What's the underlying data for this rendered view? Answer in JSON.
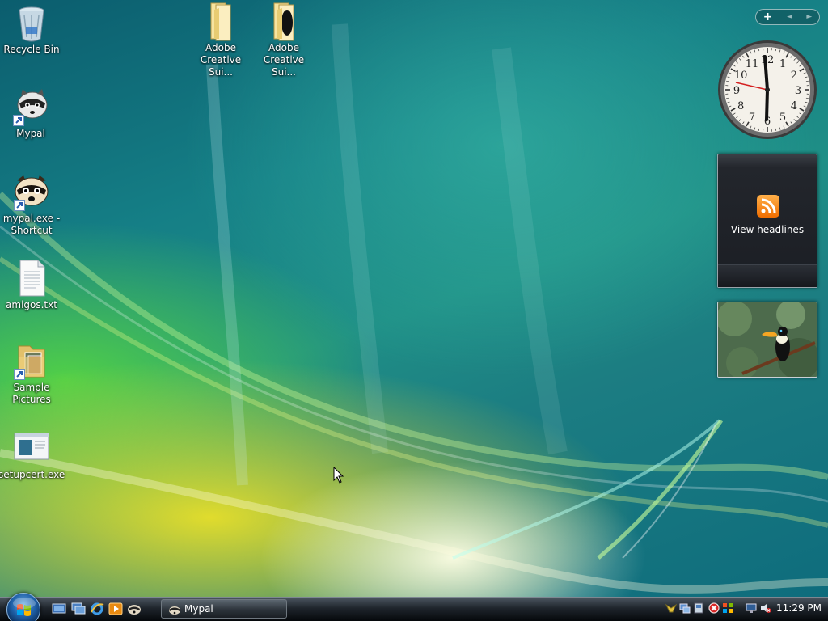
{
  "desktop": {
    "icons": [
      {
        "label": "Recycle Bin",
        "icon": "recycle-bin-icon"
      },
      {
        "label": "Mypal",
        "icon": "raccoon-icon",
        "shortcut": true
      },
      {
        "label": "mypal.exe - Shortcut",
        "icon": "raccoon-icon",
        "shortcut": true
      },
      {
        "label": "amigos.txt",
        "icon": "text-file-icon"
      },
      {
        "label": "Sample Pictures",
        "icon": "folder-icon",
        "shortcut": true
      },
      {
        "label": "setupcert.exe",
        "icon": "setup-exe-icon"
      },
      {
        "label": "Adobe Creative Sui...",
        "icon": "folder-icon"
      },
      {
        "label": "Adobe Creative Sui...",
        "icon": "folder-icon"
      }
    ]
  },
  "sidebar": {
    "controls": {
      "add": "+",
      "prev": "◄",
      "next": "►"
    },
    "clock": {
      "numerals": [
        "12",
        "1",
        "2",
        "3",
        "4",
        "5",
        "6",
        "7",
        "8",
        "9",
        "10",
        "11"
      ]
    },
    "feed": {
      "label": "View headlines"
    },
    "slideshow": {
      "subject": "toucan"
    }
  },
  "taskbar": {
    "start_button": "start-orb",
    "quick_launch": [
      "show-desktop-icon",
      "switch-windows-icon",
      "internet-explorer-icon",
      "media-player-icon",
      "mypal-icon"
    ],
    "task_buttons": [
      {
        "label": "Mypal",
        "icon": "mypal-icon"
      }
    ],
    "tray_icons": [
      "tray-app-icon",
      "tray-network-icon",
      "tray-device-icon",
      "tray-security-icon",
      "tray-windows-icon",
      "tray-display-icon",
      "volume-muted-icon"
    ],
    "clock": "11:29 PM"
  },
  "colors": {
    "accent_orange": "#f06d00",
    "taskbar_dark": "#1f252c",
    "wallpaper_teal": "#157f86"
  }
}
